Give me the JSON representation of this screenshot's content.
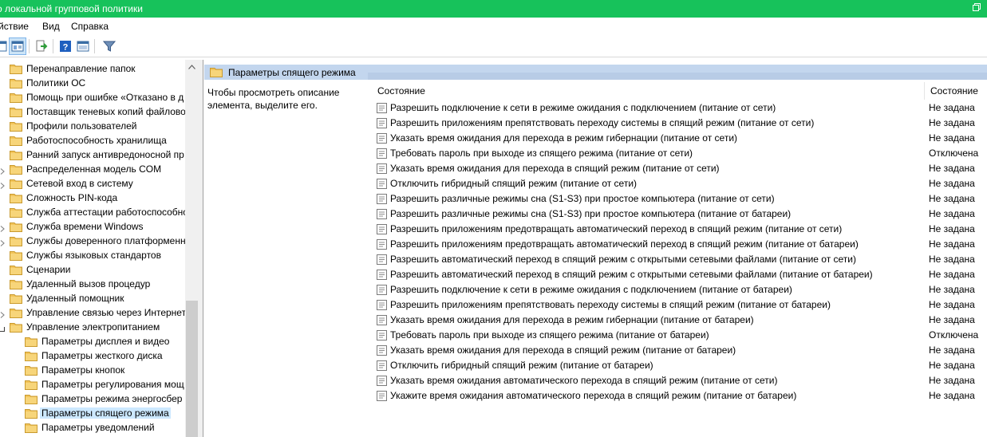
{
  "window": {
    "title": "о локальной групповой политики"
  },
  "menu": [
    "йствие",
    "Вид",
    "Справка"
  ],
  "toolbar": {
    "buttons": [
      "show-hide-tree-icon",
      "properties-pane-icon",
      "export-list-icon",
      "help-icon",
      "view-pane-icon",
      "filter-icon"
    ]
  },
  "tree": {
    "items": [
      {
        "label": "Перенаправление папок",
        "level": 1,
        "expandable": false
      },
      {
        "label": "Политики ОС",
        "level": 1,
        "expandable": false
      },
      {
        "label": "Помощь при ошибке «Отказано в д",
        "level": 1,
        "expandable": false
      },
      {
        "label": "Поставщик теневых копий файлово",
        "level": 1,
        "expandable": false
      },
      {
        "label": "Профили пользователей",
        "level": 1,
        "expandable": false
      },
      {
        "label": "Работоспособность хранилища",
        "level": 1,
        "expandable": false
      },
      {
        "label": "Ранний запуск антивредоносной пр",
        "level": 1,
        "expandable": false
      },
      {
        "label": "Распределенная модель COM",
        "level": 1,
        "expandable": true
      },
      {
        "label": "Сетевой вход в систему",
        "level": 1,
        "expandable": true
      },
      {
        "label": "Сложность PIN-кода",
        "level": 1,
        "expandable": false
      },
      {
        "label": "Служба аттестации работоспособно",
        "level": 1,
        "expandable": false
      },
      {
        "label": "Служба времени Windows",
        "level": 1,
        "expandable": true
      },
      {
        "label": "Службы доверенного платформенн",
        "level": 1,
        "expandable": true
      },
      {
        "label": "Службы языковых стандартов",
        "level": 1,
        "expandable": false
      },
      {
        "label": "Сценарии",
        "level": 1,
        "expandable": false
      },
      {
        "label": "Удаленный вызов процедур",
        "level": 1,
        "expandable": false
      },
      {
        "label": "Удаленный помощник",
        "level": 1,
        "expandable": false
      },
      {
        "label": "Управление связью через Интернет",
        "level": 1,
        "expandable": true
      },
      {
        "label": "Управление электропитанием",
        "level": 1,
        "expandable": true,
        "expanded": true
      },
      {
        "label": "Параметры дисплея и видео",
        "level": 2,
        "expandable": false
      },
      {
        "label": "Параметры жесткого диска",
        "level": 2,
        "expandable": false
      },
      {
        "label": "Параметры кнопок",
        "level": 2,
        "expandable": false
      },
      {
        "label": "Параметры регулирования мощ",
        "level": 2,
        "expandable": false
      },
      {
        "label": "Параметры режима энергосбер",
        "level": 2,
        "expandable": false
      },
      {
        "label": "Параметры спящего режима",
        "level": 2,
        "expandable": false,
        "selected": true
      },
      {
        "label": "Параметры уведомлений",
        "level": 2,
        "expandable": false
      }
    ]
  },
  "pane": {
    "tab_title": "Параметры спящего режима",
    "description": "Чтобы просмотреть описание элемента, выделите его.",
    "columns": {
      "name": "Состояние",
      "state": "Состояние"
    },
    "rows": [
      {
        "name": "Разрешить подключение к сети в режиме ожидания с подключением (питание от сети)",
        "state": "Не задана"
      },
      {
        "name": "Разрешить приложениям препятствовать переходу системы в спящий режим (питание от сети)",
        "state": "Не задана"
      },
      {
        "name": "Указать время ожидания для перехода в режим гибернации (питание от сети)",
        "state": "Не задана"
      },
      {
        "name": "Требовать пароль при выходе из спящего режима (питание от сети)",
        "state": "Отключена"
      },
      {
        "name": "Указать время ожидания для перехода в спящий режим (питание от сети)",
        "state": "Не задана"
      },
      {
        "name": "Отключить гибридный спящий режим (питание от сети)",
        "state": "Не задана"
      },
      {
        "name": "Разрешить различные режимы сна (S1-S3) при простое компьютера (питание от сети)",
        "state": "Не задана"
      },
      {
        "name": "Разрешить различные режимы сна (S1-S3) при простое компьютера (питание от батареи)",
        "state": "Не задана"
      },
      {
        "name": "Разрешить приложениям предотвращать автоматический переход в спящий режим (питание от сети)",
        "state": "Не задана"
      },
      {
        "name": "Разрешить приложениям предотвращать автоматический переход в спящий режим (питание от батареи)",
        "state": "Не задана"
      },
      {
        "name": "Разрешить автоматический переход в спящий режим с открытыми сетевыми файлами (питание от сети)",
        "state": "Не задана"
      },
      {
        "name": "Разрешить автоматический переход в спящий режим с открытыми сетевыми файлами (питание от батареи)",
        "state": "Не задана"
      },
      {
        "name": "Разрешить подключение к сети в режиме ожидания с подключением (питание от батареи)",
        "state": "Не задана"
      },
      {
        "name": "Разрешить приложениям препятствовать переходу системы в спящий режим (питание от батареи)",
        "state": "Не задана"
      },
      {
        "name": "Указать время ожидания для перехода в режим гибернации (питание от батареи)",
        "state": "Не задана"
      },
      {
        "name": "Требовать пароль при выходе из спящего режима (питание от батареи)",
        "state": "Отключена"
      },
      {
        "name": "Указать время ожидания для перехода в спящий режим (питание от батареи)",
        "state": "Не задана"
      },
      {
        "name": "Отключить гибридный спящий режим (питание от батареи)",
        "state": "Не задана"
      },
      {
        "name": "Указать время ожидания автоматического перехода в спящий режим (питание от сети)",
        "state": "Не задана"
      },
      {
        "name": "Укажите время ожидания автоматического перехода в спящий режим (питание от батареи)",
        "state": "Не задана"
      }
    ]
  },
  "colors": {
    "titlebar": "#17c25b",
    "pane_header": "#c3d6ee",
    "selection": "#cce8ff",
    "folder": "#f2c45a"
  }
}
